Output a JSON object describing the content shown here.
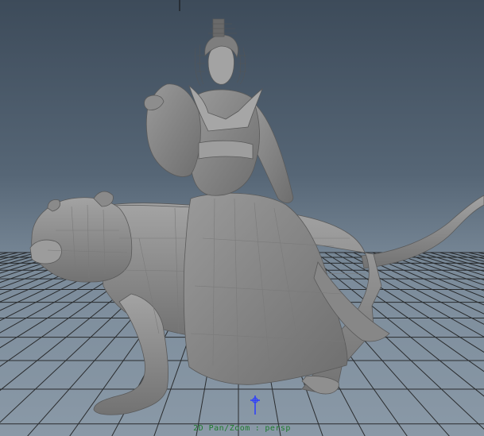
{
  "viewport": {
    "camera": "persp",
    "tool": "2D Pan/Zoom",
    "separator": ":"
  },
  "colors": {
    "background_top": "#3d4b5a",
    "background_bottom": "#8a99a7",
    "grid_line": "#1a1a1a",
    "model_gray": "#8c8c8c",
    "hud_text": "#1f7a2e",
    "manipulator": "#2a3cff"
  },
  "icons": {
    "manipulator": "pivot-manipulator-icon"
  }
}
